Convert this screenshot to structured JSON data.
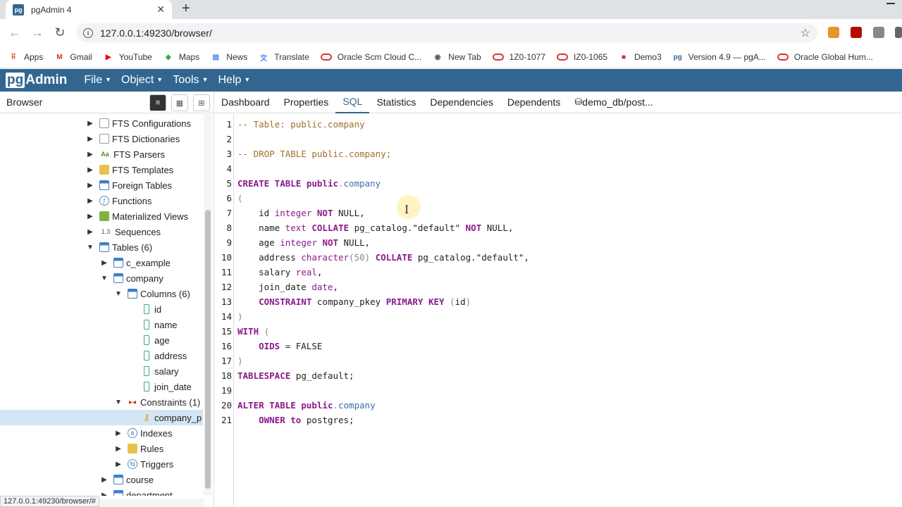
{
  "browser": {
    "tab_title": "pgAdmin 4",
    "tab_icon": "pg",
    "url": "127.0.0.1:49230/browser/",
    "bookmarks": [
      {
        "label": "Apps",
        "icon": "apps-icon"
      },
      {
        "label": "Gmail",
        "icon": "gmail-icon"
      },
      {
        "label": "YouTube",
        "icon": "youtube-icon"
      },
      {
        "label": "Maps",
        "icon": "maps-icon"
      },
      {
        "label": "News",
        "icon": "news-icon"
      },
      {
        "label": "Translate",
        "icon": "translate-icon"
      },
      {
        "label": "Oracle Scm Cloud C...",
        "icon": "oracle-icon"
      },
      {
        "label": "New Tab",
        "icon": "globe-icon"
      },
      {
        "label": "1Z0-1077",
        "icon": "oracle-icon"
      },
      {
        "label": "IZ0-1065",
        "icon": "oracle-icon"
      },
      {
        "label": "Demo3",
        "icon": "bookmark-icon"
      },
      {
        "label": "Version 4.9 — pgA...",
        "icon": "pg-icon"
      },
      {
        "label": "Oracle Global Hum...",
        "icon": "oracle-icon"
      }
    ],
    "status_url": "127.0.0.1:49230/browser/#"
  },
  "app": {
    "logo_pg": "pg",
    "logo_rest": "Admin",
    "menus": [
      "File",
      "Object",
      "Tools",
      "Help"
    ]
  },
  "browser_panel": {
    "title": "Browser",
    "tree": [
      {
        "label": "FTS Configurations",
        "icon": "fts-icon",
        "level": 1,
        "expand": "collapsed"
      },
      {
        "label": "FTS Dictionaries",
        "icon": "fts-icon",
        "level": 1,
        "expand": "collapsed"
      },
      {
        "label": "FTS Parsers",
        "icon": "aa-icon",
        "level": 1,
        "expand": "collapsed"
      },
      {
        "label": "FTS Templates",
        "icon": "fts-template-icon",
        "level": 1,
        "expand": "collapsed"
      },
      {
        "label": "Foreign Tables",
        "icon": "table-icon",
        "level": 1,
        "expand": "collapsed"
      },
      {
        "label": "Functions",
        "icon": "function-icon",
        "level": 1,
        "expand": "collapsed"
      },
      {
        "label": "Materialized Views",
        "icon": "matview-icon",
        "level": 1,
        "expand": "collapsed"
      },
      {
        "label": "Sequences",
        "icon": "sequence-icon",
        "level": 1,
        "expand": "collapsed"
      },
      {
        "label": "Tables (6)",
        "icon": "table-icon",
        "level": 1,
        "expand": "expanded"
      },
      {
        "label": "c_example",
        "icon": "table-icon",
        "level": 2,
        "expand": "collapsed"
      },
      {
        "label": "company",
        "icon": "table-icon",
        "level": 2,
        "expand": "expanded"
      },
      {
        "label": "Columns (6)",
        "icon": "columns-icon",
        "level": 3,
        "expand": "expanded"
      },
      {
        "label": "id",
        "icon": "column-icon",
        "level": 4,
        "expand": "none"
      },
      {
        "label": "name",
        "icon": "column-icon",
        "level": 4,
        "expand": "none"
      },
      {
        "label": "age",
        "icon": "column-icon",
        "level": 4,
        "expand": "none"
      },
      {
        "label": "address",
        "icon": "column-icon",
        "level": 4,
        "expand": "none"
      },
      {
        "label": "salary",
        "icon": "column-icon",
        "level": 4,
        "expand": "none"
      },
      {
        "label": "join_date",
        "icon": "column-icon",
        "level": 4,
        "expand": "none"
      },
      {
        "label": "Constraints (1)",
        "icon": "constraints-icon",
        "level": 3,
        "expand": "expanded"
      },
      {
        "label": "company_p",
        "icon": "key-icon",
        "level": 4,
        "expand": "none",
        "selected": true
      },
      {
        "label": "Indexes",
        "icon": "index-icon",
        "level": 3,
        "expand": "collapsed"
      },
      {
        "label": "Rules",
        "icon": "rules-icon",
        "level": 3,
        "expand": "collapsed"
      },
      {
        "label": "Triggers",
        "icon": "trigger-icon",
        "level": 3,
        "expand": "collapsed"
      },
      {
        "label": "course",
        "icon": "table-icon",
        "level": 2,
        "expand": "collapsed"
      },
      {
        "label": "department",
        "icon": "table-icon",
        "level": 2,
        "expand": "collapsed"
      }
    ]
  },
  "tabs": [
    "Dashboard",
    "Properties",
    "SQL",
    "Statistics",
    "Dependencies",
    "Dependents",
    "demo_db/post..."
  ],
  "active_tab": "SQL",
  "sql_lines": [
    [
      [
        "cm",
        "-- Table: public.company"
      ]
    ],
    [],
    [
      [
        "cm",
        "-- DROP TABLE public.company;"
      ]
    ],
    [],
    [
      [
        "kw",
        "CREATE TABLE "
      ],
      [
        "kw",
        "public"
      ],
      [
        "pn",
        "."
      ],
      [
        "fn",
        "company"
      ]
    ],
    [
      [
        "pn",
        "("
      ]
    ],
    [
      [
        "st",
        "    id "
      ],
      [
        "ty",
        "integer "
      ],
      [
        "kw",
        "NOT "
      ],
      [
        "st",
        "NULL,"
      ]
    ],
    [
      [
        "st",
        "    name "
      ],
      [
        "ty",
        "text "
      ],
      [
        "kw",
        "COLLATE "
      ],
      [
        "st",
        "pg_catalog.\"default\" "
      ],
      [
        "kw",
        "NOT "
      ],
      [
        "st",
        "NULL,"
      ]
    ],
    [
      [
        "st",
        "    age "
      ],
      [
        "ty",
        "integer "
      ],
      [
        "kw",
        "NOT "
      ],
      [
        "st",
        "NULL,"
      ]
    ],
    [
      [
        "st",
        "    address "
      ],
      [
        "ty",
        "character"
      ],
      [
        "pn",
        "(50) "
      ],
      [
        "kw",
        "COLLATE "
      ],
      [
        "st",
        "pg_catalog.\"default\","
      ]
    ],
    [
      [
        "st",
        "    salary "
      ],
      [
        "ty",
        "real"
      ],
      [
        "st",
        ","
      ]
    ],
    [
      [
        "st",
        "    join_date "
      ],
      [
        "ty",
        "date"
      ],
      [
        "st",
        ","
      ]
    ],
    [
      [
        "kw",
        "    CONSTRAINT "
      ],
      [
        "st",
        "company_pkey "
      ],
      [
        "kw",
        "PRIMARY KEY "
      ],
      [
        "pn",
        "("
      ],
      [
        "st",
        "id"
      ],
      [
        "pn",
        ")"
      ]
    ],
    [
      [
        "pn",
        ")"
      ]
    ],
    [
      [
        "kw",
        "WITH "
      ],
      [
        "pn",
        "("
      ]
    ],
    [
      [
        "kw",
        "    OIDS "
      ],
      [
        "st",
        "= FALSE"
      ]
    ],
    [
      [
        "pn",
        ")"
      ]
    ],
    [
      [
        "kw",
        "TABLESPACE "
      ],
      [
        "st",
        "pg_default;"
      ]
    ],
    [],
    [
      [
        "kw",
        "ALTER TABLE "
      ],
      [
        "kw",
        "public"
      ],
      [
        "pn",
        "."
      ],
      [
        "fn",
        "company"
      ]
    ],
    [
      [
        "kw",
        "    OWNER "
      ],
      [
        "kw",
        "to "
      ],
      [
        "st",
        "postgres;"
      ]
    ]
  ],
  "colors": {
    "brand": "#326690",
    "selected_row": "#d3e5f5"
  }
}
